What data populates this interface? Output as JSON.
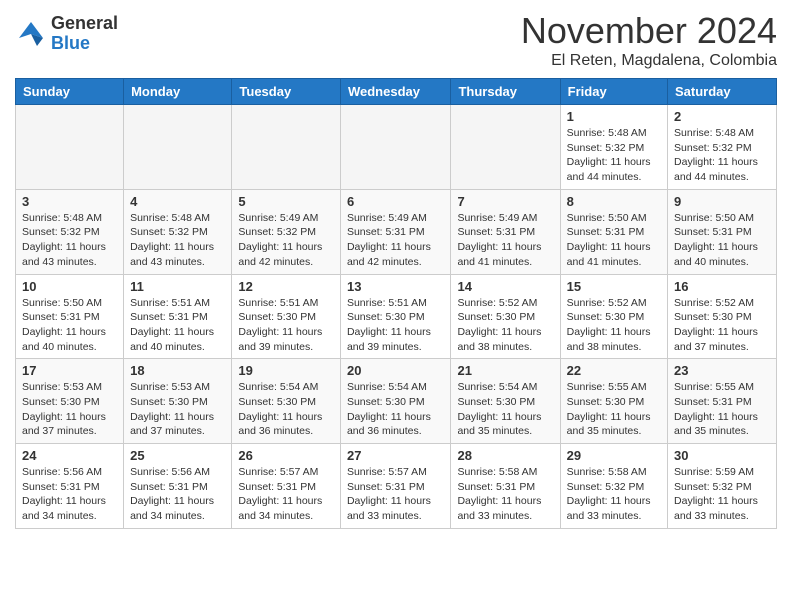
{
  "logo": {
    "general": "General",
    "blue": "Blue"
  },
  "header": {
    "month_title": "November 2024",
    "subtitle": "El Reten, Magdalena, Colombia"
  },
  "weekdays": [
    "Sunday",
    "Monday",
    "Tuesday",
    "Wednesday",
    "Thursday",
    "Friday",
    "Saturday"
  ],
  "weeks": [
    [
      {
        "day": "",
        "empty": true
      },
      {
        "day": "",
        "empty": true
      },
      {
        "day": "",
        "empty": true
      },
      {
        "day": "",
        "empty": true
      },
      {
        "day": "",
        "empty": true
      },
      {
        "day": "1",
        "sunrise": "5:48 AM",
        "sunset": "5:32 PM",
        "daylight": "11 hours and 44 minutes."
      },
      {
        "day": "2",
        "sunrise": "5:48 AM",
        "sunset": "5:32 PM",
        "daylight": "11 hours and 44 minutes."
      }
    ],
    [
      {
        "day": "3",
        "sunrise": "5:48 AM",
        "sunset": "5:32 PM",
        "daylight": "11 hours and 43 minutes."
      },
      {
        "day": "4",
        "sunrise": "5:48 AM",
        "sunset": "5:32 PM",
        "daylight": "11 hours and 43 minutes."
      },
      {
        "day": "5",
        "sunrise": "5:49 AM",
        "sunset": "5:32 PM",
        "daylight": "11 hours and 42 minutes."
      },
      {
        "day": "6",
        "sunrise": "5:49 AM",
        "sunset": "5:31 PM",
        "daylight": "11 hours and 42 minutes."
      },
      {
        "day": "7",
        "sunrise": "5:49 AM",
        "sunset": "5:31 PM",
        "daylight": "11 hours and 41 minutes."
      },
      {
        "day": "8",
        "sunrise": "5:50 AM",
        "sunset": "5:31 PM",
        "daylight": "11 hours and 41 minutes."
      },
      {
        "day": "9",
        "sunrise": "5:50 AM",
        "sunset": "5:31 PM",
        "daylight": "11 hours and 40 minutes."
      }
    ],
    [
      {
        "day": "10",
        "sunrise": "5:50 AM",
        "sunset": "5:31 PM",
        "daylight": "11 hours and 40 minutes."
      },
      {
        "day": "11",
        "sunrise": "5:51 AM",
        "sunset": "5:31 PM",
        "daylight": "11 hours and 40 minutes."
      },
      {
        "day": "12",
        "sunrise": "5:51 AM",
        "sunset": "5:30 PM",
        "daylight": "11 hours and 39 minutes."
      },
      {
        "day": "13",
        "sunrise": "5:51 AM",
        "sunset": "5:30 PM",
        "daylight": "11 hours and 39 minutes."
      },
      {
        "day": "14",
        "sunrise": "5:52 AM",
        "sunset": "5:30 PM",
        "daylight": "11 hours and 38 minutes."
      },
      {
        "day": "15",
        "sunrise": "5:52 AM",
        "sunset": "5:30 PM",
        "daylight": "11 hours and 38 minutes."
      },
      {
        "day": "16",
        "sunrise": "5:52 AM",
        "sunset": "5:30 PM",
        "daylight": "11 hours and 37 minutes."
      }
    ],
    [
      {
        "day": "17",
        "sunrise": "5:53 AM",
        "sunset": "5:30 PM",
        "daylight": "11 hours and 37 minutes."
      },
      {
        "day": "18",
        "sunrise": "5:53 AM",
        "sunset": "5:30 PM",
        "daylight": "11 hours and 37 minutes."
      },
      {
        "day": "19",
        "sunrise": "5:54 AM",
        "sunset": "5:30 PM",
        "daylight": "11 hours and 36 minutes."
      },
      {
        "day": "20",
        "sunrise": "5:54 AM",
        "sunset": "5:30 PM",
        "daylight": "11 hours and 36 minutes."
      },
      {
        "day": "21",
        "sunrise": "5:54 AM",
        "sunset": "5:30 PM",
        "daylight": "11 hours and 35 minutes."
      },
      {
        "day": "22",
        "sunrise": "5:55 AM",
        "sunset": "5:30 PM",
        "daylight": "11 hours and 35 minutes."
      },
      {
        "day": "23",
        "sunrise": "5:55 AM",
        "sunset": "5:31 PM",
        "daylight": "11 hours and 35 minutes."
      }
    ],
    [
      {
        "day": "24",
        "sunrise": "5:56 AM",
        "sunset": "5:31 PM",
        "daylight": "11 hours and 34 minutes."
      },
      {
        "day": "25",
        "sunrise": "5:56 AM",
        "sunset": "5:31 PM",
        "daylight": "11 hours and 34 minutes."
      },
      {
        "day": "26",
        "sunrise": "5:57 AM",
        "sunset": "5:31 PM",
        "daylight": "11 hours and 34 minutes."
      },
      {
        "day": "27",
        "sunrise": "5:57 AM",
        "sunset": "5:31 PM",
        "daylight": "11 hours and 33 minutes."
      },
      {
        "day": "28",
        "sunrise": "5:58 AM",
        "sunset": "5:31 PM",
        "daylight": "11 hours and 33 minutes."
      },
      {
        "day": "29",
        "sunrise": "5:58 AM",
        "sunset": "5:32 PM",
        "daylight": "11 hours and 33 minutes."
      },
      {
        "day": "30",
        "sunrise": "5:59 AM",
        "sunset": "5:32 PM",
        "daylight": "11 hours and 33 minutes."
      }
    ]
  ],
  "labels": {
    "sunrise": "Sunrise:",
    "sunset": "Sunset:",
    "daylight": "Daylight:"
  }
}
